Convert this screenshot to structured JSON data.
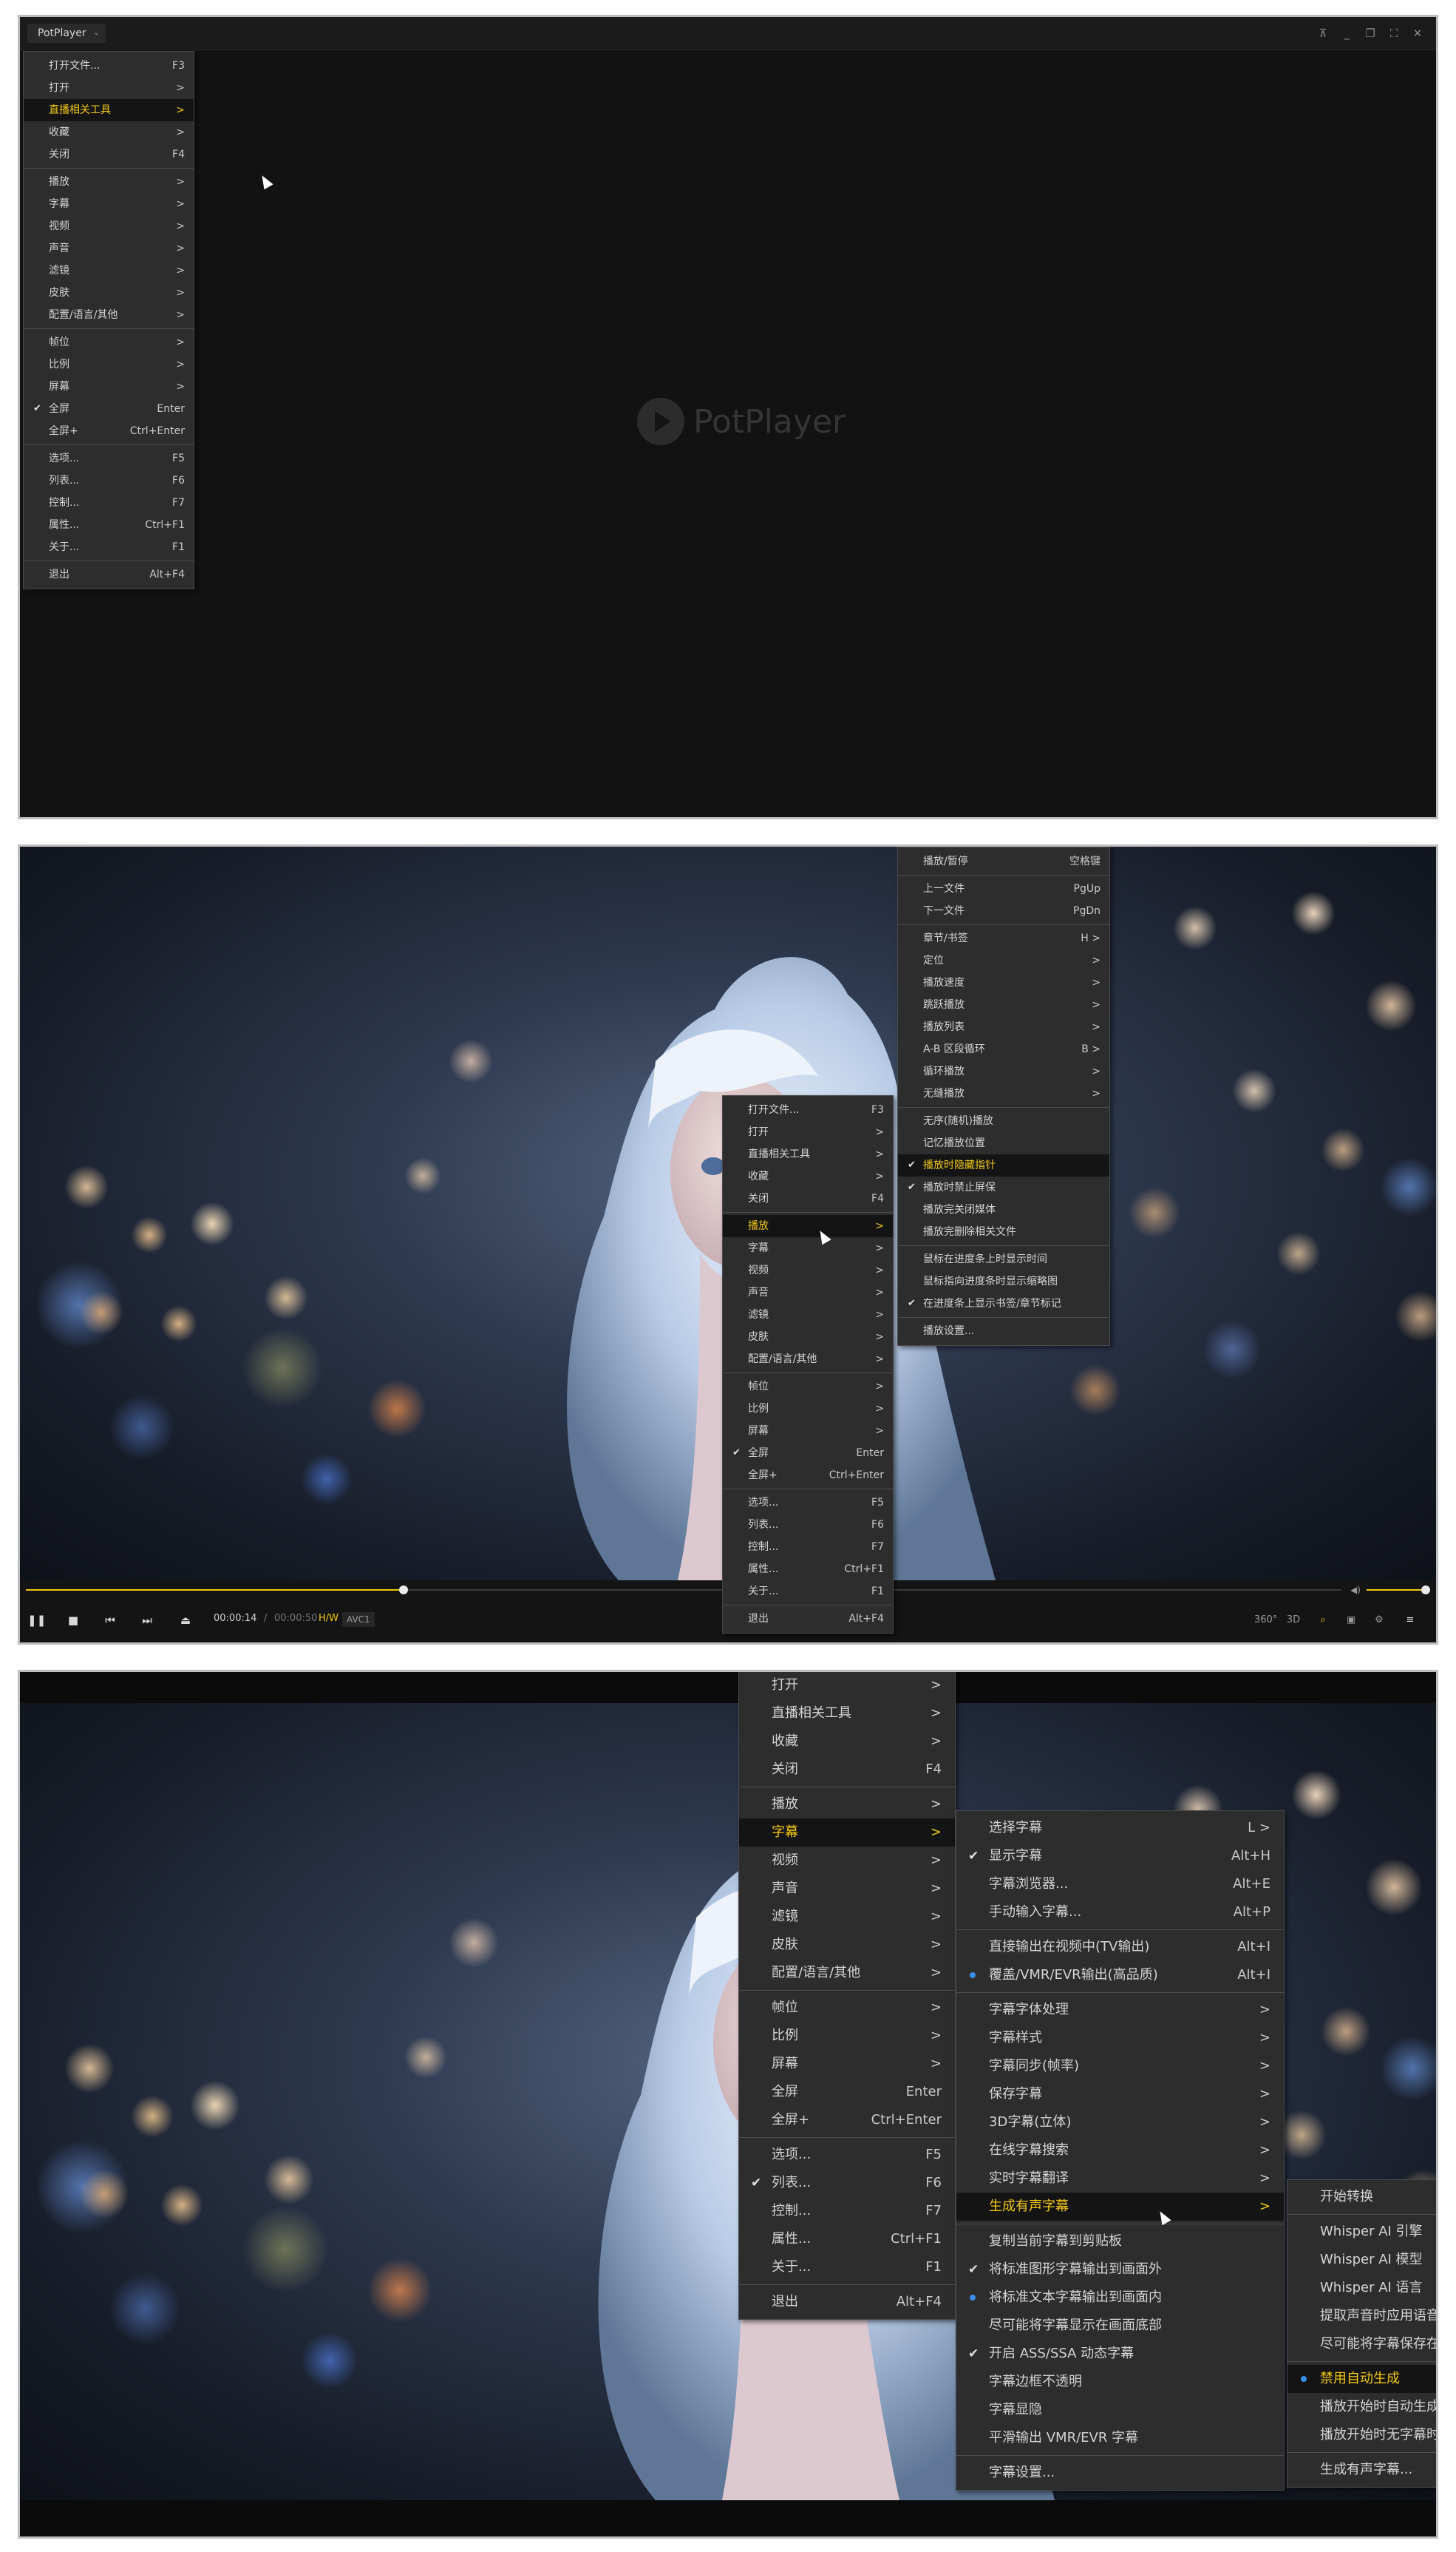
{
  "app": {
    "title": "PotPlayer",
    "logo_text": "PotPlayer"
  },
  "window_controls": [
    "pin-icon",
    "minimize-icon",
    "restore-icon",
    "fullscreen-icon",
    "close-icon"
  ],
  "main_menu": [
    {
      "label": "打开文件...",
      "shortcut": "F3"
    },
    {
      "label": "打开",
      "shortcut": ">"
    },
    {
      "label": "直播相关工具",
      "shortcut": ">"
    },
    {
      "label": "收藏",
      "shortcut": ">"
    },
    {
      "label": "关闭",
      "shortcut": "F4"
    },
    {
      "label": "播放",
      "shortcut": ">"
    },
    {
      "label": "字幕",
      "shortcut": ">"
    },
    {
      "label": "视频",
      "shortcut": ">"
    },
    {
      "label": "声音",
      "shortcut": ">"
    },
    {
      "label": "滤镜",
      "shortcut": ">"
    },
    {
      "label": "皮肤",
      "shortcut": ">"
    },
    {
      "label": "配置/语言/其他",
      "shortcut": ">"
    },
    {
      "label": "帧位",
      "shortcut": ">"
    },
    {
      "label": "比例",
      "shortcut": ">"
    },
    {
      "label": "屏幕",
      "shortcut": ">"
    },
    {
      "label": "全屏",
      "shortcut": "Enter"
    },
    {
      "label": "全屏+",
      "shortcut": "Ctrl+Enter"
    },
    {
      "label": "选项...",
      "shortcut": "F5"
    },
    {
      "label": "列表...",
      "shortcut": "F6"
    },
    {
      "label": "控制...",
      "shortcut": "F7"
    },
    {
      "label": "属性...",
      "shortcut": "Ctrl+F1"
    },
    {
      "label": "关于...",
      "shortcut": "F1"
    },
    {
      "label": "退出",
      "shortcut": "Alt+F4"
    }
  ],
  "play_menu": [
    {
      "label": "播放/暂停",
      "shortcut": "空格键"
    },
    {
      "label": "上一文件",
      "shortcut": "PgUp"
    },
    {
      "label": "下一文件",
      "shortcut": "PgDn"
    },
    {
      "label": "章节/书签",
      "shortcut": "H >"
    },
    {
      "label": "定位",
      "shortcut": ">"
    },
    {
      "label": "播放速度",
      "shortcut": ">"
    },
    {
      "label": "跳跃播放",
      "shortcut": ">"
    },
    {
      "label": "播放列表",
      "shortcut": ">"
    },
    {
      "label": "A-B 区段循环",
      "shortcut": "B >"
    },
    {
      "label": "循环播放",
      "shortcut": ">"
    },
    {
      "label": "无缝播放",
      "shortcut": ">"
    },
    {
      "label": "无序(随机)播放",
      "shortcut": ""
    },
    {
      "label": "记忆播放位置",
      "shortcut": ""
    },
    {
      "label": "播放时隐藏指针",
      "shortcut": ""
    },
    {
      "label": "播放时禁止屏保",
      "shortcut": ""
    },
    {
      "label": "播放完关闭媒体",
      "shortcut": ""
    },
    {
      "label": "播放完删除相关文件",
      "shortcut": ""
    },
    {
      "label": "鼠标在进度条上时显示时间",
      "shortcut": ""
    },
    {
      "label": "鼠标指向进度条时显示缩略图",
      "shortcut": ""
    },
    {
      "label": "在进度条上显示书签/章节标记",
      "shortcut": ""
    },
    {
      "label": "播放设置...",
      "shortcut": ""
    }
  ],
  "playback": {
    "current": "00:00:14",
    "separator": "/",
    "total": "00:00:50",
    "hw": "H/W",
    "codec": "AVC1"
  },
  "control_right": {
    "vr": "360°",
    "three_d": "3D"
  },
  "subtitle_menu": [
    {
      "label": "选择字幕",
      "shortcut": "L >"
    },
    {
      "label": "显示字幕",
      "shortcut": "Alt+H"
    },
    {
      "label": "字幕浏览器...",
      "shortcut": "Alt+E"
    },
    {
      "label": "手动输入字幕...",
      "shortcut": "Alt+P"
    },
    {
      "label": "直接输出在视频中(TV输出)",
      "shortcut": "Alt+I"
    },
    {
      "label": "覆盖/VMR/EVR输出(高品质)",
      "shortcut": "Alt+I"
    },
    {
      "label": "字幕字体处理",
      "shortcut": ">"
    },
    {
      "label": "字幕样式",
      "shortcut": ">"
    },
    {
      "label": "字幕同步(帧率)",
      "shortcut": ">"
    },
    {
      "label": "保存字幕",
      "shortcut": ">"
    },
    {
      "label": "3D字幕(立体)",
      "shortcut": ">"
    },
    {
      "label": "在线字幕搜索",
      "shortcut": ">"
    },
    {
      "label": "实时字幕翻译",
      "shortcut": ">"
    },
    {
      "label": "生成有声字幕",
      "shortcut": ">"
    },
    {
      "label": "复制当前字幕到剪贴板",
      "shortcut": ""
    },
    {
      "label": "将标准图形字幕输出到画面外",
      "shortcut": ""
    },
    {
      "label": "将标准文本字幕输出到画面内",
      "shortcut": ""
    },
    {
      "label": "尽可能将字幕显示在画面底部",
      "shortcut": ""
    },
    {
      "label": "开启 ASS/SSA 动态字幕",
      "shortcut": ""
    },
    {
      "label": "字幕边框不透明",
      "shortcut": ""
    },
    {
      "label": "字幕显隐",
      "shortcut": ""
    },
    {
      "label": "平滑输出 VMR/EVR 字幕",
      "shortcut": ""
    },
    {
      "label": "字幕设置...",
      "shortcut": ""
    }
  ],
  "audio_sub_menu": [
    {
      "label": "开始转换"
    },
    {
      "label": "Whisper AI 引擎"
    },
    {
      "label": "Whisper AI 模型"
    },
    {
      "label": "Whisper AI 语言"
    },
    {
      "label": "提取声音时应用语音"
    },
    {
      "label": "尽可能将字幕保存在"
    },
    {
      "label": "禁用自动生成"
    },
    {
      "label": "播放开始时自动生成"
    },
    {
      "label": "播放开始时无字幕时"
    },
    {
      "label": "生成有声字幕..."
    }
  ]
}
